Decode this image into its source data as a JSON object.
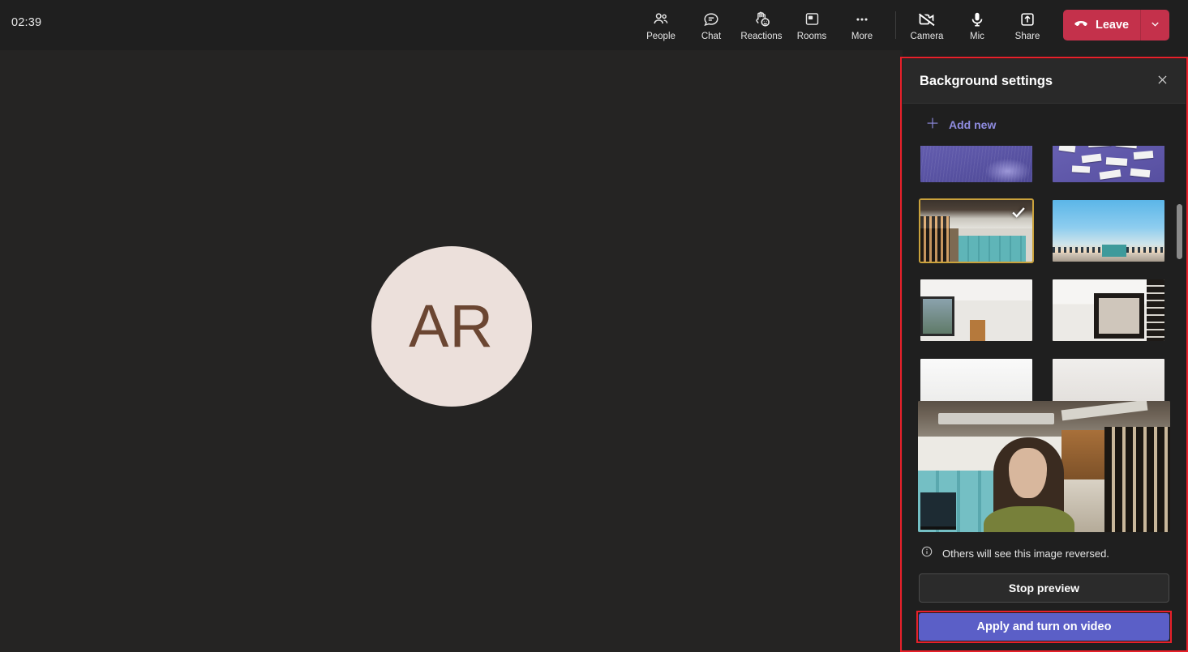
{
  "meeting": {
    "timer": "02:39",
    "avatar_initials": "AR",
    "avatar_bg": "#ece0db",
    "avatar_fg": "#6b4632"
  },
  "toolbar": {
    "items": [
      {
        "label": "People",
        "icon": "people-icon"
      },
      {
        "label": "Chat",
        "icon": "chat-icon"
      },
      {
        "label": "Reactions",
        "icon": "reactions-icon"
      },
      {
        "label": "Rooms",
        "icon": "rooms-icon"
      },
      {
        "label": "More",
        "icon": "more-icon"
      }
    ],
    "device_items": [
      {
        "label": "Camera",
        "icon": "camera-off-icon",
        "state": "off"
      },
      {
        "label": "Mic",
        "icon": "mic-icon",
        "state": "on"
      },
      {
        "label": "Share",
        "icon": "share-icon",
        "state": "off"
      }
    ],
    "leave_label": "Leave",
    "leave_color": "#c4314b",
    "leave_caret_icon": "chevron-down-icon"
  },
  "panel": {
    "title": "Background settings",
    "close_icon": "close-icon",
    "add_new_label": "Add new",
    "add_new_icon": "plus-icon",
    "accent_color": "#8f8ce0",
    "highlight_color": "#e8202a",
    "selected_border_color": "#caa23c",
    "thumbnails": [
      {
        "name": "purple-blur-background",
        "art": "art-purple-blur",
        "selected": false
      },
      {
        "name": "sticky-notes-background",
        "art": "art-notes",
        "selected": false
      },
      {
        "name": "office-lockers-background",
        "art": "art-office",
        "selected": true
      },
      {
        "name": "beach-sunset-background",
        "art": "art-beach",
        "selected": false
      },
      {
        "name": "white-room-window-background",
        "art": "art-room1",
        "selected": false
      },
      {
        "name": "white-room-mirror-background",
        "art": "art-room2",
        "selected": false
      },
      {
        "name": "white-interior-background",
        "art": "art-white1",
        "selected": false
      },
      {
        "name": "light-interior-background",
        "art": "art-white2",
        "selected": false
      }
    ],
    "preview_note": "Others will see this image reversed.",
    "info_icon": "info-icon",
    "stop_preview_label": "Stop preview",
    "apply_label": "Apply and turn on video",
    "apply_color": "#5b5fc7"
  }
}
